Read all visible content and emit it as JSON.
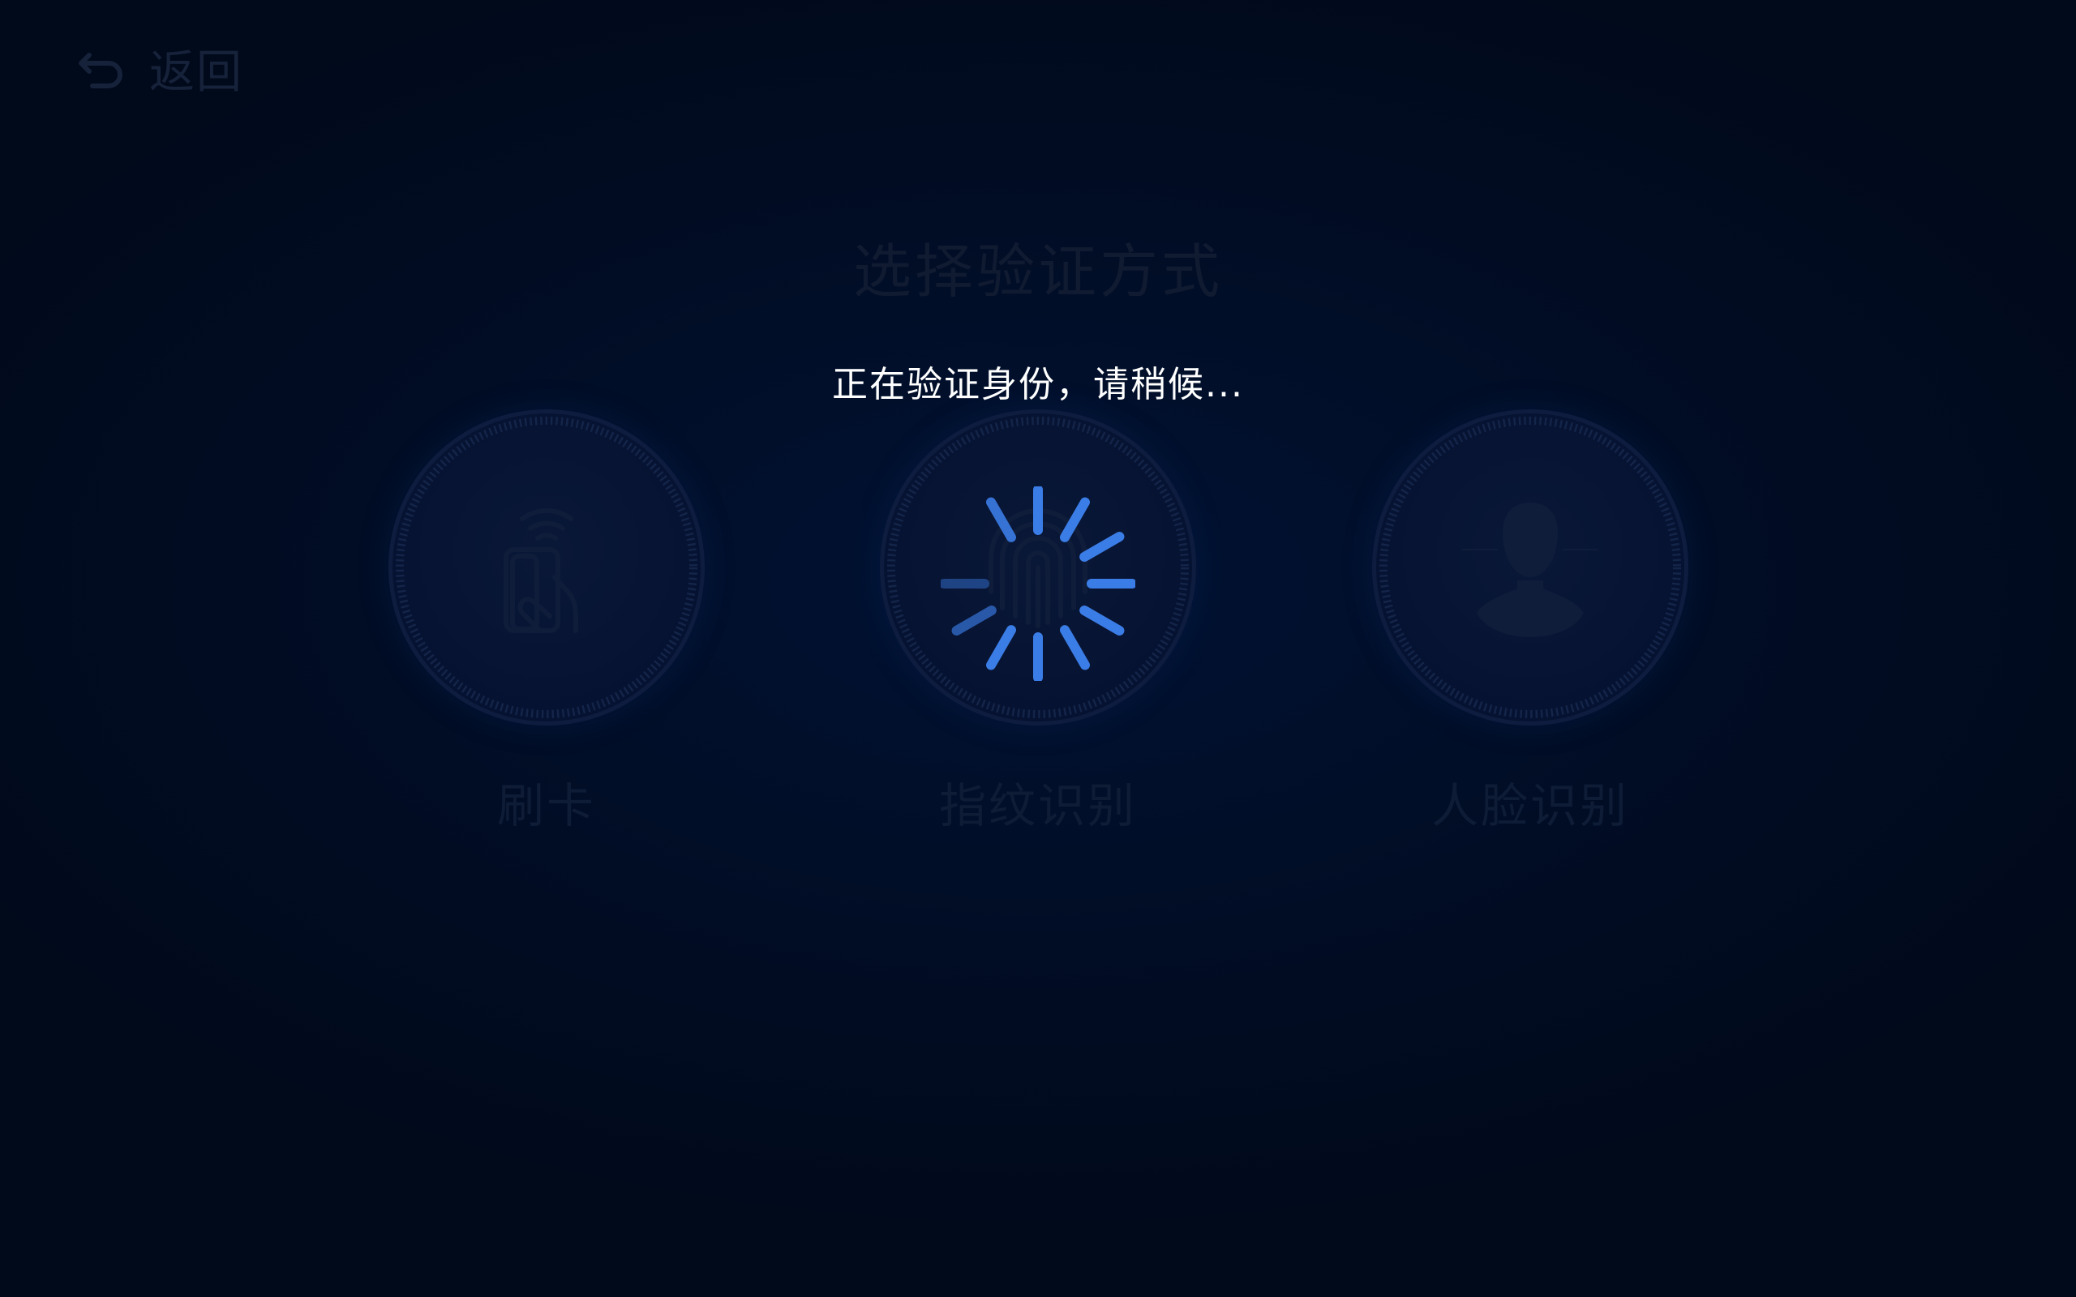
{
  "nav": {
    "back_icon": "undo-arrow-icon",
    "back_label": "返回"
  },
  "page": {
    "title": "选择验证方式"
  },
  "options": [
    {
      "label": "刷卡",
      "icon": "card-tap-icon"
    },
    {
      "label": "指纹识别",
      "icon": "fingerprint-icon"
    },
    {
      "label": "人脸识别",
      "icon": "face-profile-icon"
    }
  ],
  "loading": {
    "message": "正在验证身份，请稍候...",
    "spinner_color": "#3b7de6"
  },
  "colors": {
    "background": "#010c1f",
    "dim_text": "#16213a",
    "accent": "#3b7de6"
  }
}
